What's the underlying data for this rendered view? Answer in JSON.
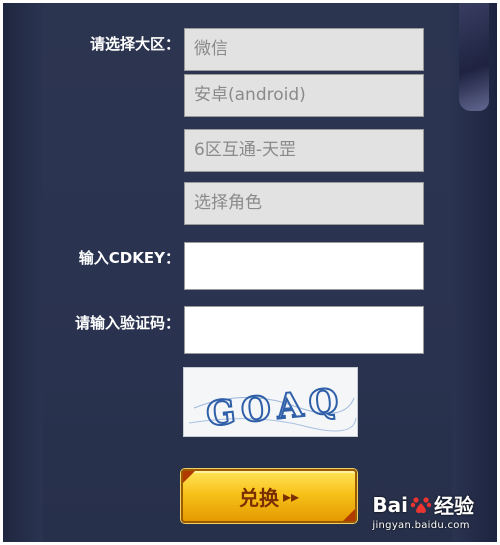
{
  "form": {
    "region_label": "请选择大区：",
    "region_platform": "微信",
    "region_os": "安卓(android)",
    "region_server": "6区互通-天罡",
    "region_role": "选择角色",
    "cdkey_label": "输入CDKEY：",
    "captcha_label": "请输入验证码：",
    "captcha_text": "GOAQ",
    "redeem_label": "兑换",
    "redeem_arrows": "▸▸"
  },
  "watermark": {
    "brand_a": "Bai",
    "brand_b": "经验",
    "url": "jingyan.baidu.com"
  },
  "colors": {
    "panel": "#2a3350",
    "field_bg": "#e2e2e2",
    "button_gold": "#f7c21a",
    "button_text": "#7a2d00",
    "captcha_text": "#2f5fa8"
  }
}
